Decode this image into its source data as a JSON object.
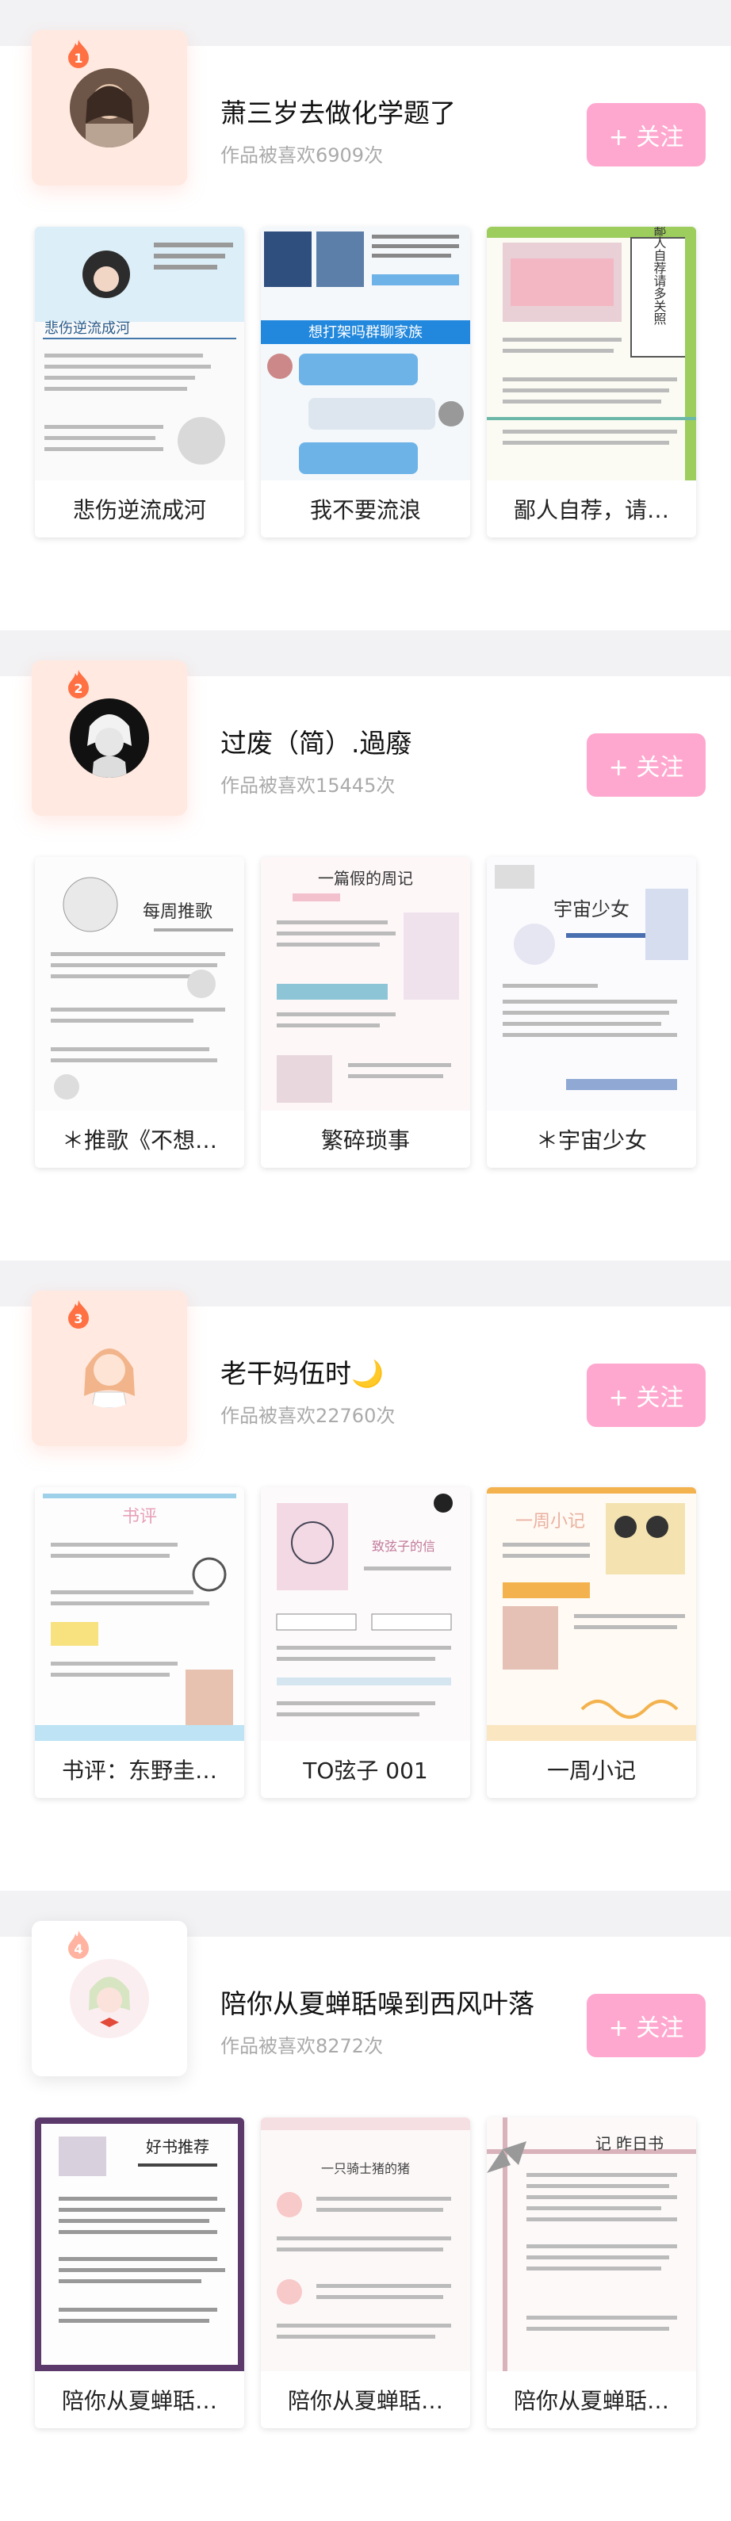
{
  "creators": [
    {
      "rank": "1",
      "name": "萧三岁去做化学题了",
      "likes": "作品被喜欢6909次",
      "follow_label": "+ 关注",
      "works": [
        {
          "title": "悲伤逆流成河",
          "thumb_text": "悲伤逆流成河"
        },
        {
          "title": "我不要流浪",
          "thumb_text": "想打架吗群聊家族"
        },
        {
          "title": "鄙人自荐，请…",
          "thumb_text": "鄙人自荐请多关照"
        }
      ]
    },
    {
      "rank": "2",
      "name": "过废（简）.過廢",
      "likes": "作品被喜欢15445次",
      "follow_label": "+ 关注",
      "works": [
        {
          "title": "＊推歌《不想…",
          "thumb_text": "每周推歌"
        },
        {
          "title": "繁碎琐事",
          "thumb_text": "一篇假的周记"
        },
        {
          "title": "＊宇宙少女",
          "thumb_text": "宇宙少女"
        }
      ]
    },
    {
      "rank": "3",
      "name": "老干妈伍时🌙",
      "likes": "作品被喜欢22760次",
      "follow_label": "+ 关注",
      "works": [
        {
          "title": "书评：东野圭…",
          "thumb_text": "书评"
        },
        {
          "title": "TO弦子 001",
          "thumb_text": "致弦子的信"
        },
        {
          "title": "一周小记",
          "thumb_text": "一周小记"
        }
      ]
    },
    {
      "rank": "4",
      "name": "陪你从夏蝉聒噪到西风叶落",
      "likes": "作品被喜欢8272次",
      "follow_label": "+ 关注",
      "works": [
        {
          "title": "陪你从夏蝉聒…",
          "thumb_text": "好书推荐"
        },
        {
          "title": "陪你从夏蝉聒…",
          "thumb_text": "一只骑士猪的猪"
        },
        {
          "title": "陪你从夏蝉聒…",
          "thumb_text": "记 昨日书"
        }
      ]
    }
  ],
  "colors": {
    "follow_button": "#ffa8cf",
    "separator": "#f2f2f4",
    "rank_flame": "#ff7043"
  },
  "icons": {
    "rank": "flame-badge-icon",
    "follow": "plus-icon"
  }
}
